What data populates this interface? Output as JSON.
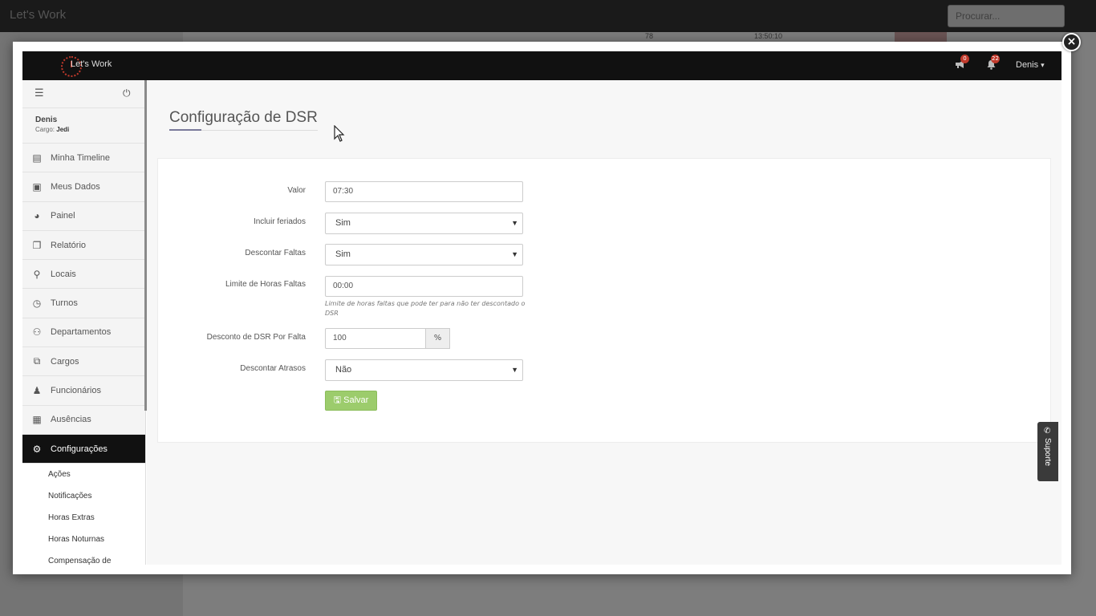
{
  "background": {
    "app_title": "Let's Work",
    "search_placeholder": "Procurar...",
    "strip_values": [
      "78",
      "13:50:10"
    ]
  },
  "modal": {
    "close_label": "×"
  },
  "header": {
    "logo_text": "Let's Work",
    "announcements_badge": "0",
    "notifications_badge": "22",
    "user_name": "Denis",
    "user_chevron": "⌄",
    "icons": {
      "announcements": "megaphone-icon",
      "notifications": "bell-icon"
    }
  },
  "sidebar": {
    "menu_icon": "☰",
    "power_icon": "⏻",
    "user_name": "Denis",
    "role_label": "Cargo:",
    "role_value": "Jedi",
    "items": [
      {
        "label": "Minha Timeline",
        "icon": "▤"
      },
      {
        "label": "Meus Dados",
        "icon": "▣"
      },
      {
        "label": "Painel",
        "icon": "◕"
      },
      {
        "label": "Relatório",
        "icon": "❐"
      },
      {
        "label": "Locais",
        "icon": "⚲"
      },
      {
        "label": "Turnos",
        "icon": "◷"
      },
      {
        "label": "Departamentos",
        "icon": "⚇"
      },
      {
        "label": "Cargos",
        "icon": "⧉"
      },
      {
        "label": "Funcionários",
        "icon": "♟"
      },
      {
        "label": "Ausências",
        "icon": "▦"
      },
      {
        "label": "Configurações",
        "icon": "⚙"
      }
    ],
    "subitems": [
      "Ações",
      "Notificações",
      "Horas Extras",
      "Horas Noturnas",
      "Compensação de"
    ]
  },
  "page": {
    "title": "Configuração de DSR"
  },
  "form": {
    "valor_label": "Valor",
    "valor_value": "07:30",
    "feriados_label": "Incluir feriados",
    "feriados_value": "Sim",
    "faltas_label": "Descontar Faltas",
    "faltas_value": "Sim",
    "limite_label": "Limite de Horas Faltas",
    "limite_value": "00:00",
    "limite_help": "Limite de horas faltas que pode ter para não ter descontado o DSR",
    "desconto_label": "Desconto de DSR Por Falta",
    "desconto_value": "100",
    "desconto_addon": "%",
    "atrasos_label": "Descontar Atrasos",
    "atrasos_value": "Não",
    "caret": "▼",
    "save_label": "Salvar",
    "save_icon": "🖫"
  },
  "support": {
    "label": "Suporte",
    "icon": "✆"
  },
  "colors": {
    "save_button": "#9ccc6c",
    "active_nav": "#111111",
    "badge": "#c0392b"
  }
}
